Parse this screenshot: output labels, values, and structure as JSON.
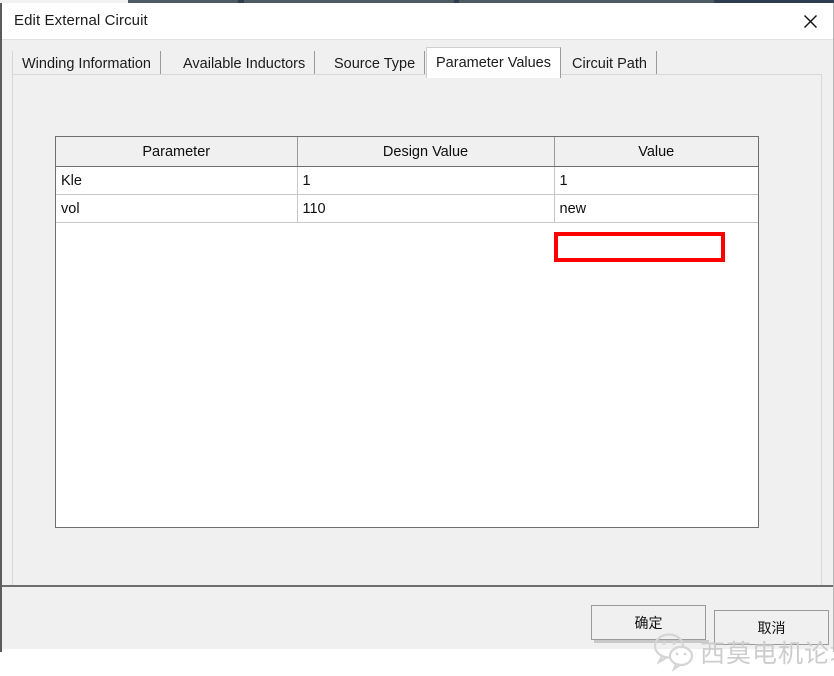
{
  "window": {
    "title": "Edit External Circuit",
    "close_icon": "close-icon"
  },
  "tabs": [
    {
      "label": "Winding Information",
      "selected": false
    },
    {
      "label": "Available Inductors",
      "selected": false
    },
    {
      "label": "Source Type",
      "selected": false
    },
    {
      "label": "Parameter Values",
      "selected": true
    },
    {
      "label": "Circuit Path",
      "selected": false
    }
  ],
  "table": {
    "columns": [
      "Parameter",
      "Design Value",
      "Value"
    ],
    "rows": [
      {
        "parameter": "Kle",
        "design_value": "1",
        "value": "1"
      },
      {
        "parameter": "vol",
        "design_value": "110",
        "value": "new"
      }
    ]
  },
  "annotation": {
    "type": "red-rectangle",
    "color": "#ff0000",
    "targets": "value-cell-row-2"
  },
  "footer": {
    "ok_label": "确定",
    "cancel_label": "取消"
  },
  "watermark": {
    "text": "西莫电机论坛",
    "logo": "wechat-logo",
    "color": "#cdcdcd"
  }
}
